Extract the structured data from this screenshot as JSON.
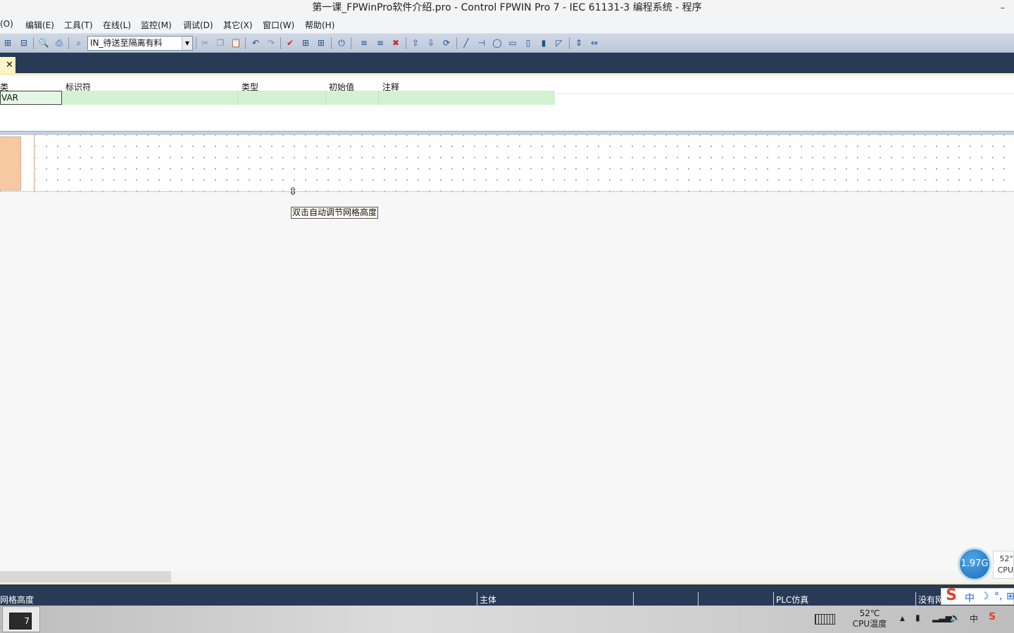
{
  "window": {
    "title": "第一课_FPWinPro软件介绍.pro - Control FPWIN Pro 7 - IEC 61131-3 编程系统 - 程序",
    "minimize": "–"
  },
  "menu": [
    "(O)",
    "编辑(E)",
    "工具(T)",
    "在线(L)",
    "监控(M)",
    "调试(D)",
    "其它(X)",
    "窗口(W)",
    "帮助(H)"
  ],
  "toolbar": {
    "pou_select_value": "IN_待送至隔离有料",
    "dropdown_arrow": "▼"
  },
  "document_tab": {
    "label": "'",
    "close": "✕"
  },
  "variable_table": {
    "columns": [
      "类",
      "标识符",
      "类型",
      "初始值",
      "注释"
    ],
    "rows": [
      {
        "class": "VAR",
        "identifier": "",
        "type": "",
        "initial": "",
        "comment": ""
      }
    ]
  },
  "ladder": {
    "resize_cursor": "⇳",
    "tooltip": "双击自动调节网格高度"
  },
  "statusbar": {
    "message": "网格高度",
    "mode": "主体",
    "plc": "PLC仿真",
    "network": "没有网"
  },
  "monitor_widget": {
    "memory": "1.97G",
    "temp": "52°",
    "cpu": "CPU"
  },
  "ime_bar": {
    "logo": "S",
    "lang": "中",
    "moon": "☽",
    "punct": "°,",
    "more": "⊞"
  },
  "taskbar": {
    "app_badge": "7",
    "tray_temp": "52℃",
    "tray_temp_label": "CPU温度",
    "tray_arrow": "▲",
    "tray_lang": "中",
    "tray_ime": "S"
  }
}
